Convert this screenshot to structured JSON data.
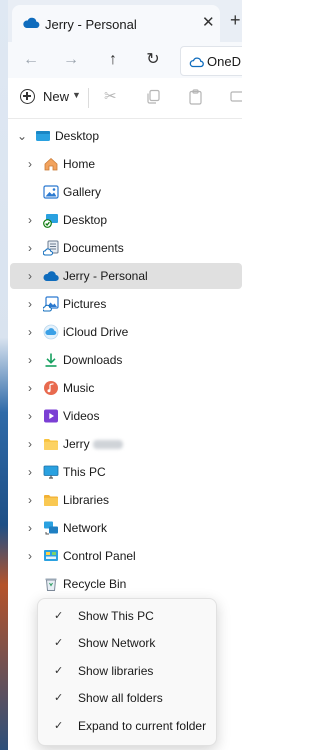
{
  "window": {
    "tab_title": "Jerry - Personal",
    "address_text": "OneD"
  },
  "command_bar": {
    "new_label": "New"
  },
  "tree": [
    {
      "label": "Desktop",
      "icon": "desktop-folder-icon",
      "chevron": "expanded"
    },
    {
      "label": "Home",
      "icon": "home-icon",
      "chevron": "collapsed"
    },
    {
      "label": "Gallery",
      "icon": "gallery-icon",
      "chevron": "none"
    },
    {
      "label": "Desktop",
      "icon": "desktop-synced-icon",
      "chevron": "collapsed"
    },
    {
      "label": "Documents",
      "icon": "documents-cloud-icon",
      "chevron": "collapsed"
    },
    {
      "label": "Jerry - Personal",
      "icon": "onedrive-cloud-icon",
      "chevron": "collapsed",
      "selected": true
    },
    {
      "label": "Pictures",
      "icon": "pictures-icon",
      "chevron": "collapsed"
    },
    {
      "label": "iCloud Drive",
      "icon": "icloud-icon",
      "chevron": "collapsed"
    },
    {
      "label": "Downloads",
      "icon": "download-icon",
      "chevron": "collapsed"
    },
    {
      "label": "Music",
      "icon": "music-icon",
      "chevron": "collapsed"
    },
    {
      "label": "Videos",
      "icon": "videos-icon",
      "chevron": "collapsed"
    },
    {
      "label": "Jerry",
      "icon": "user-folder-icon",
      "chevron": "collapsed",
      "redacted": true
    },
    {
      "label": "This PC",
      "icon": "this-pc-icon",
      "chevron": "collapsed"
    },
    {
      "label": "Libraries",
      "icon": "libraries-icon",
      "chevron": "collapsed"
    },
    {
      "label": "Network",
      "icon": "network-icon",
      "chevron": "collapsed"
    },
    {
      "label": "Control Panel",
      "icon": "control-panel-icon",
      "chevron": "collapsed"
    },
    {
      "label": "Recycle Bin",
      "icon": "recycle-bin-icon",
      "chevron": "none"
    }
  ],
  "context_menu": {
    "items": [
      {
        "label": "Show This PC",
        "checked": true
      },
      {
        "label": "Show Network",
        "checked": true
      },
      {
        "label": "Show libraries",
        "checked": true
      },
      {
        "label": "Show all folders",
        "checked": true
      },
      {
        "label": "Expand to current folder",
        "checked": true
      }
    ]
  },
  "colors": {
    "accent": "#0f6cbd",
    "selected_row": "#e0e0e0",
    "tab_bar": "#e9eef5"
  }
}
